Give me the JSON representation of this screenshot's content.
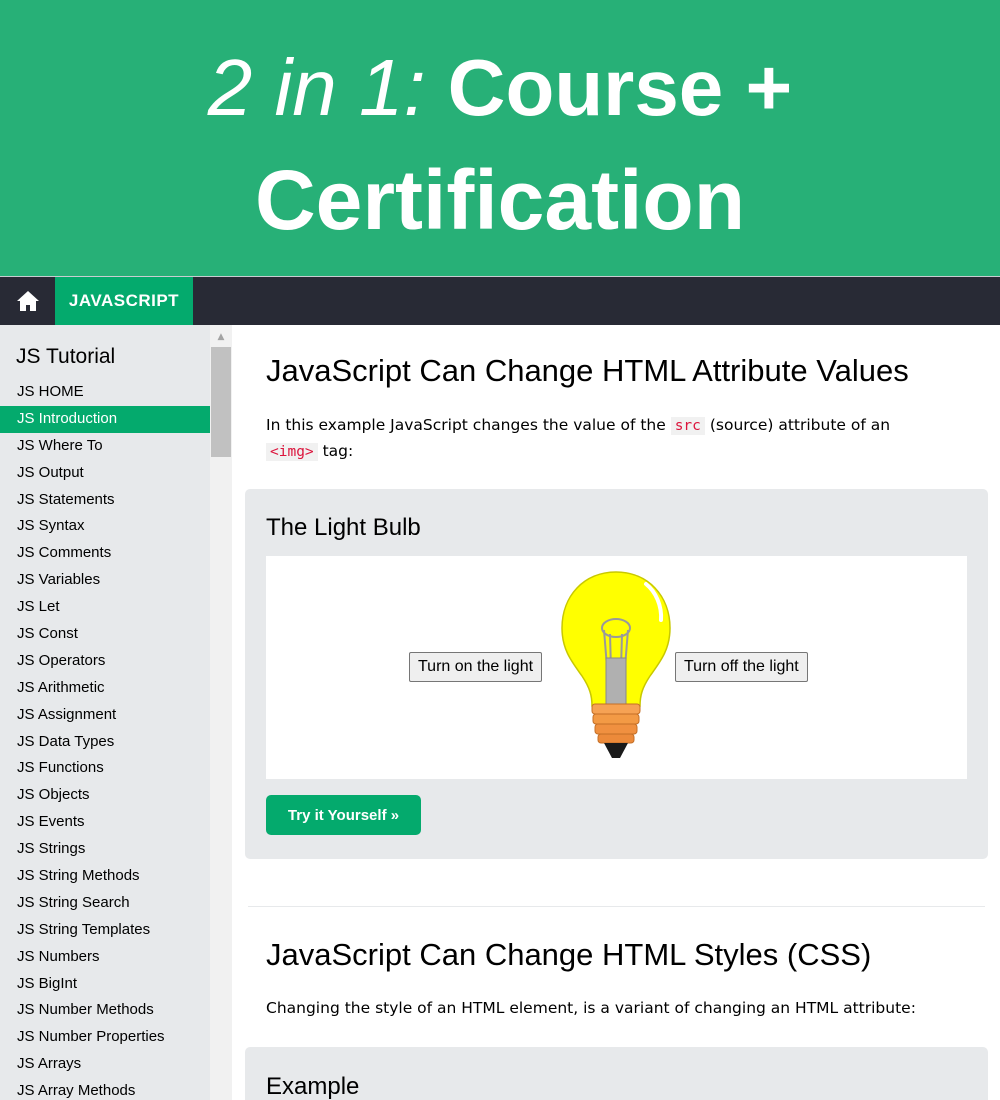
{
  "banner": {
    "italic_text": "2 in 1:",
    "bold_text": "Course +",
    "line2": "Certification",
    "background": "#27b077"
  },
  "topnav": {
    "home_icon": "home-icon",
    "tab_label": "JAVASCRIPT",
    "accent": "#04aa6d"
  },
  "sidebar": {
    "title": "JS Tutorial",
    "items": [
      {
        "label": "JS HOME",
        "active": false
      },
      {
        "label": "JS Introduction",
        "active": true
      },
      {
        "label": "JS Where To",
        "active": false
      },
      {
        "label": "JS Output",
        "active": false
      },
      {
        "label": "JS Statements",
        "active": false
      },
      {
        "label": "JS Syntax",
        "active": false
      },
      {
        "label": "JS Comments",
        "active": false
      },
      {
        "label": "JS Variables",
        "active": false
      },
      {
        "label": "JS Let",
        "active": false
      },
      {
        "label": "JS Const",
        "active": false
      },
      {
        "label": "JS Operators",
        "active": false
      },
      {
        "label": "JS Arithmetic",
        "active": false
      },
      {
        "label": "JS Assignment",
        "active": false
      },
      {
        "label": "JS Data Types",
        "active": false
      },
      {
        "label": "JS Functions",
        "active": false
      },
      {
        "label": "JS Objects",
        "active": false
      },
      {
        "label": "JS Events",
        "active": false
      },
      {
        "label": "JS Strings",
        "active": false
      },
      {
        "label": "JS String Methods",
        "active": false
      },
      {
        "label": "JS String Search",
        "active": false
      },
      {
        "label": "JS String Templates",
        "active": false
      },
      {
        "label": "JS Numbers",
        "active": false
      },
      {
        "label": "JS BigInt",
        "active": false
      },
      {
        "label": "JS Number Methods",
        "active": false
      },
      {
        "label": "JS Number Properties",
        "active": false
      },
      {
        "label": "JS Arrays",
        "active": false
      },
      {
        "label": "JS Array Methods",
        "active": false
      }
    ]
  },
  "main": {
    "section1": {
      "heading": "JavaScript Can Change HTML Attribute Values",
      "text_before": "In this example JavaScript changes the value of the ",
      "code1": "src",
      "text_middle": " (source) attribute of an ",
      "code2": "<img>",
      "text_after": " tag:",
      "example": {
        "title": "The Light Bulb",
        "button_on": "Turn on the light",
        "button_off": "Turn off the light",
        "bulb_icon": "lightbulb-icon",
        "try_button": "Try it Yourself »"
      }
    },
    "section2": {
      "heading": "JavaScript Can Change HTML Styles (CSS)",
      "text": "Changing the style of an HTML element, is a variant of changing an HTML attribute:",
      "example_title": "Example"
    }
  }
}
